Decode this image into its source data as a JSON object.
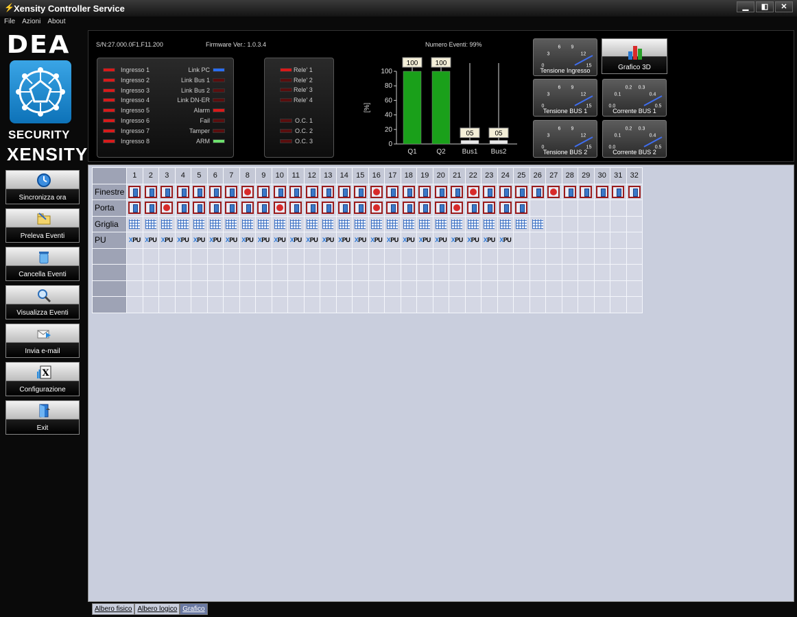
{
  "window": {
    "title": "Xensity Controller Service",
    "buttons": [
      "▁",
      "◧",
      "✕"
    ]
  },
  "menu": [
    "File",
    "Azioni",
    "About"
  ],
  "brand": {
    "dea": "DEA",
    "security": "SECURITY",
    "xensity": "XENSITY"
  },
  "sidebar": [
    {
      "label": "Sincronizza ora",
      "icon": "clock-icon"
    },
    {
      "label": "Preleva Eventi",
      "icon": "folder-icon"
    },
    {
      "label": "Cancella Eventi",
      "icon": "trash-icon"
    },
    {
      "label": "Visualizza Eventi",
      "icon": "magnifier-icon"
    },
    {
      "label": "Invia e-mail",
      "icon": "mail-icon"
    },
    {
      "label": "Configurazione",
      "icon": "config-icon"
    },
    {
      "label": "Exit",
      "icon": "door-icon"
    }
  ],
  "info": {
    "serial": "S/N:27.000.0F1.F11.200",
    "firmware": "Firmware Ver.: 1.0.3.4",
    "events": "Numero Eventi: 99%"
  },
  "inputs": [
    "Ingresso 1",
    "Ingresso 2",
    "Ingresso 3",
    "Ingresso 4",
    "Ingresso 5",
    "Ingresso 6",
    "Ingresso 7",
    "Ingresso 8"
  ],
  "status": [
    {
      "label": "Link PC",
      "color": "#2a6df0"
    },
    {
      "label": "Link Bus 1",
      "color": "#5a0e0e"
    },
    {
      "label": "Link Bus 2",
      "color": "#5a0e0e"
    },
    {
      "label": "Link DN-ER",
      "color": "#5a0e0e"
    },
    {
      "label": "Alarm",
      "color": "#d81a1a"
    },
    {
      "label": "Fail",
      "color": "#5a0e0e"
    },
    {
      "label": "Tamper",
      "color": "#5a0e0e"
    },
    {
      "label": "ARM",
      "color": "#6de06d"
    }
  ],
  "relays": [
    "Rele' 1",
    "Rele' 2",
    "Rele' 3",
    "Rele' 4"
  ],
  "oc": [
    "O.C. 1",
    "O.C. 2",
    "O.C. 3"
  ],
  "chart_data": {
    "type": "bar",
    "categories": [
      "Q1",
      "Q2",
      "Bus1",
      "Bus2"
    ],
    "values": [
      100,
      100,
      5,
      5
    ],
    "value_labels": [
      "100",
      "100",
      "05",
      "05"
    ],
    "ylabel": "[%]",
    "ylim": [
      0,
      100
    ],
    "yticks": [
      0,
      20,
      40,
      60,
      80,
      100
    ],
    "colors": [
      "#1aa01a",
      "#1aa01a",
      "#e8e8e8",
      "#e8e8e8"
    ]
  },
  "gauges": [
    {
      "label": "Tensione Ingresso",
      "ticks": [
        "0",
        "3",
        "6",
        "9",
        "12",
        "15"
      ]
    },
    {
      "label": "Tensione BUS 1",
      "ticks": [
        "0",
        "3",
        "6",
        "9",
        "12",
        "15"
      ]
    },
    {
      "label": "Tensione BUS 2",
      "ticks": [
        "0",
        "3",
        "6",
        "9",
        "12",
        "15"
      ]
    },
    {
      "label": "Corrente BUS 1",
      "ticks": [
        "0.0",
        "0.1",
        "0.2",
        "0.3",
        "0.4",
        "0.5"
      ]
    },
    {
      "label": "Corrente BUS 2",
      "ticks": [
        "0.0",
        "0.1",
        "0.2",
        "0.3",
        "0.4",
        "0.5"
      ]
    }
  ],
  "btn3d": {
    "label": "Grafico 3D"
  },
  "grid": {
    "rows": [
      "Finestre",
      "Porta",
      "Griglia",
      "PU",
      "",
      "",
      "",
      ""
    ],
    "columns": 32,
    "finestre_on": [
      8,
      16,
      22,
      27
    ],
    "porta_on": [
      3,
      10,
      16,
      21
    ],
    "porta_count": 25,
    "griglia_count": 26,
    "pu_count": 24,
    "pu_text": "PU",
    "pu_prefix": "X"
  },
  "tabs": [
    "Albero fisico",
    "Albero logico",
    "Grafico"
  ],
  "active_tab": 2
}
